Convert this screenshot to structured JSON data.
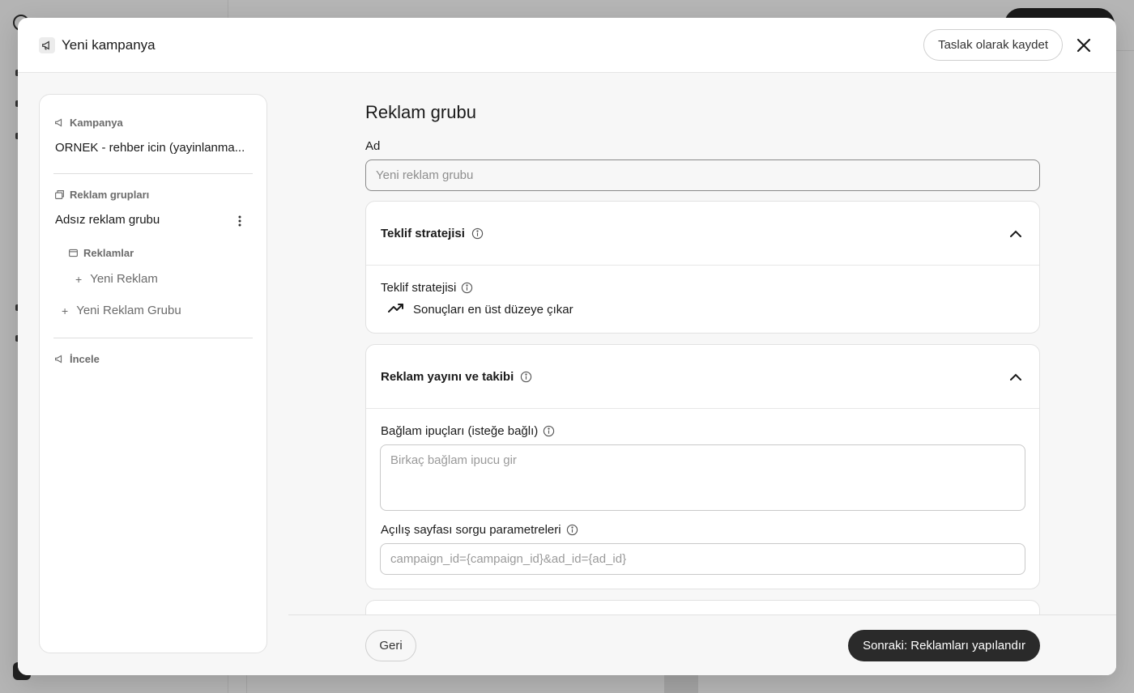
{
  "modal": {
    "title": "Yeni kampanya",
    "save_draft_label": "Taslak olarak kaydet",
    "close_icon": "close-icon"
  },
  "nav": {
    "campaign_section": "Kampanya",
    "campaign_name": "ORNEK - rehber icin (yayinlanma...",
    "adgroups_section": "Reklam grupları",
    "adgroup_name": "Adsız reklam grubu",
    "ads_section": "Reklamlar",
    "new_ad": "Yeni Reklam",
    "new_adgroup": "Yeni Reklam Grubu",
    "review_section": "İncele"
  },
  "main": {
    "section_title": "Reklam grubu",
    "name_label": "Ad",
    "name_placeholder": "Yeni reklam grubu",
    "bid_card": {
      "title": "Teklif stratejisi",
      "field_label": "Teklif stratejisi",
      "value": "Sonuçları en üst düzeye çıkar"
    },
    "delivery_card": {
      "title": "Reklam yayını ve takibi",
      "context_label": "Bağlam ipuçları (isteğe bağlı)",
      "context_placeholder": "Birkaç bağlam ipucu gir",
      "query_label": "Açılış sayfası sorgu parametreleri",
      "query_placeholder": "campaign_id={campaign_id}&ad_id={ad_id}"
    }
  },
  "footer": {
    "back_label": "Geri",
    "next_label": "Sonraki: Reklamları yapılandır"
  }
}
